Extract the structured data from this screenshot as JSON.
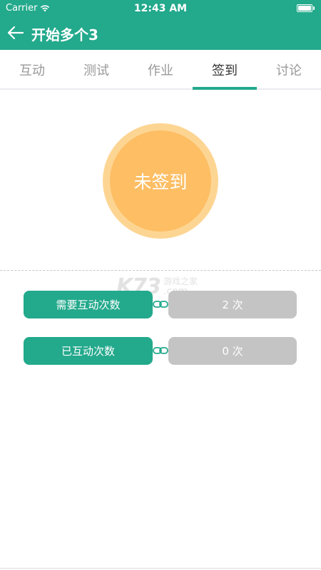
{
  "status_bar": {
    "carrier": "Carrier",
    "time": "12:43 AM"
  },
  "nav": {
    "title": "开始多个3"
  },
  "tabs": [
    {
      "label": "互动"
    },
    {
      "label": "测试"
    },
    {
      "label": "作业"
    },
    {
      "label": "签到"
    },
    {
      "label": "讨论"
    }
  ],
  "active_tab": "签到",
  "signin": {
    "label": "未签到"
  },
  "watermark": {
    "logo": "K73",
    "top": "游戏之家",
    "bottom": ".com"
  },
  "stats": [
    {
      "label": "需要互动次数",
      "value": "2 次"
    },
    {
      "label": "已互动次数",
      "value": "0 次"
    }
  ],
  "colors": {
    "primary": "#23a98c",
    "signin_outer": "#fdd593",
    "signin_inner": "#fdbe64",
    "value_bg": "#c4c4c4"
  }
}
